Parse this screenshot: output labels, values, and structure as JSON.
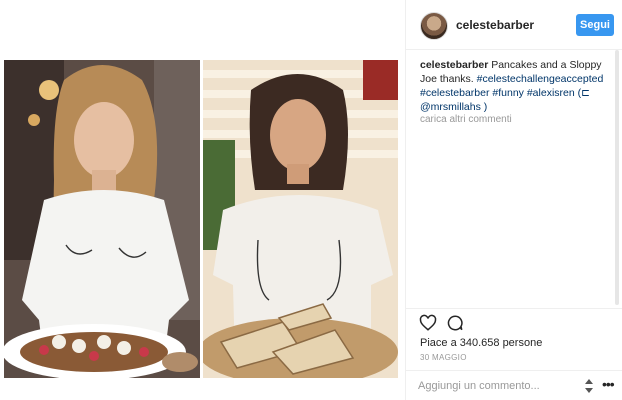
{
  "post": {
    "username": "celestebarber",
    "follow_label": "Segui",
    "caption": {
      "username": "celestebarber",
      "text": "Pancakes and a Sloppy Joe thanks.",
      "tags": [
        "#celestechallengeaccepted",
        "#celestebarber",
        "#funny",
        "#alexisren"
      ],
      "trailing": "(⊏ @mrsmillahs )"
    },
    "load_more_label": "carica altri commenti",
    "likes_text": "Piace a 340.658 persone",
    "date_text": "30 MAGGIO",
    "comment_placeholder": "Aggiungi un commento...",
    "more_label": "•••"
  },
  "icons": {
    "heart": "heart-icon",
    "comment": "comment-icon",
    "updown": "up-down-arrows-icon",
    "more": "more-options-icon"
  },
  "colors": {
    "follow_button": "#3897f0",
    "hashtag": "#003569",
    "muted": "#999999",
    "border": "#efefef"
  }
}
